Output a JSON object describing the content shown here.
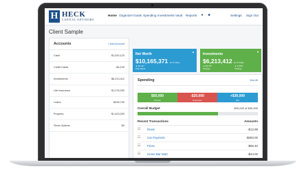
{
  "brand": {
    "mark": "H",
    "name": "HECK",
    "sub": "CAPITAL ADVISORS"
  },
  "nav": {
    "items": [
      "Home",
      "Organizer",
      "Goals",
      "Spending",
      "Investments",
      "Vault",
      "Reports"
    ],
    "settings": "Settings",
    "sign_out": "Sign Out",
    "icons": [
      "bell-icon",
      "message-icon"
    ]
  },
  "page_title": "Client Sample",
  "accounts": {
    "title": "Accounts",
    "add_label": "+ Add Account",
    "rows": [
      {
        "name": "Cash",
        "value": "$1,020,123"
      },
      {
        "name": "Credit Cards",
        "value": "-$4,193"
      },
      {
        "name": "Investments",
        "value": "$6,213,412"
      },
      {
        "name": "Life Insurance",
        "value": "$1,278,250"
      },
      {
        "name": "Loans",
        "value": "-$296,749"
      },
      {
        "name": "Property",
        "value": "$1,423,000"
      },
      {
        "name": "Stock Options",
        "value": "$0"
      }
    ]
  },
  "net_worth": {
    "title": "Net Worth",
    "value": "$10,165,371",
    "as_of": "as of today",
    "change_1": "▲ $1,417",
    "change_1_label": "Past Week",
    "chevron": "▲"
  },
  "investments": {
    "title": "Investments",
    "value": "$6,213,412",
    "as_of": "as of today",
    "change_1": "▲ $3,417",
    "change_1_label": "Change",
    "change_2": "▲ 0.05%",
    "change_2_label": "Change",
    "chevron": "▼"
  },
  "spending": {
    "title": "Spending",
    "view_all": "View All",
    "income": {
      "value": "$50,000",
      "label": "Income"
    },
    "expenses": {
      "value": "-$20,000",
      "label": "Expenses"
    },
    "net": {
      "value": "+$30,000",
      "label": "Net"
    },
    "budget_label": "Overall Budget",
    "budget_value": "$20,000 of $30,000",
    "budget_fraction": 0.67,
    "recent_title": "Recent Transactions",
    "amount_col": "Amounts",
    "transactions": [
      {
        "name": "Rows",
        "amount": "-$12.99"
      },
      {
        "name": "Car Payment",
        "amount": "-$350.00"
      },
      {
        "name": "Pizza",
        "amount": "-$55.40"
      },
      {
        "name": "Home Bar Mart",
        "amount": "-$44.00"
      }
    ]
  }
}
